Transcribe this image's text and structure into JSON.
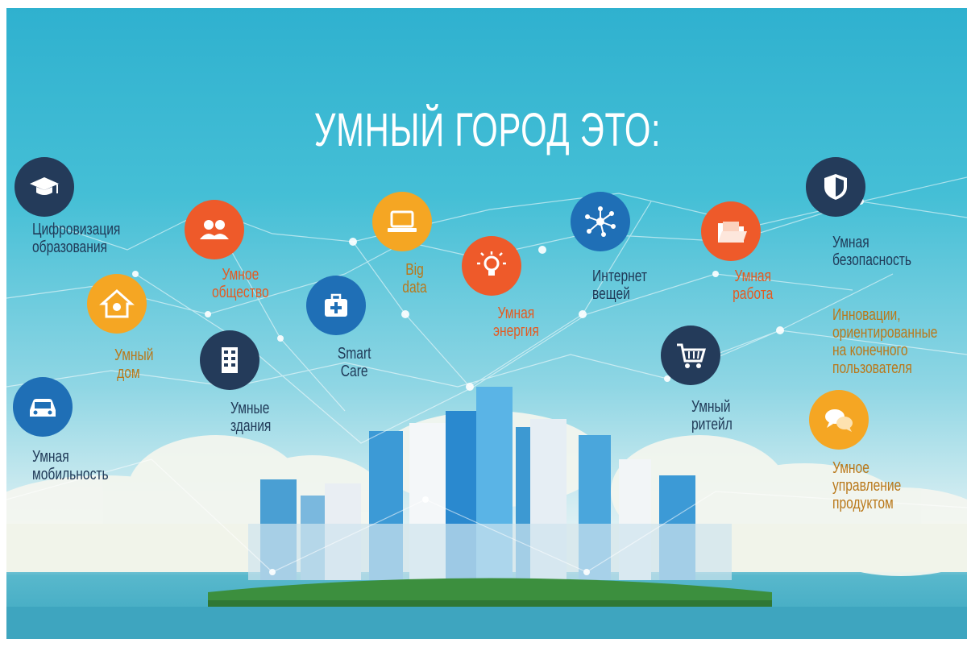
{
  "title": "УМНЫЙ ГОРОД ЭТО:",
  "colors": {
    "navy": "#243b5a",
    "blue": "#1f6fb6",
    "orange": "#ee5a2a",
    "yellow": "#f5a623",
    "sky": "#45bfd6"
  },
  "items": [
    {
      "icon": "graduation-cap-icon",
      "line1": "Цифровизация",
      "line2": "образования"
    },
    {
      "icon": "people-icon",
      "line1": "Умное",
      "line2": "общество"
    },
    {
      "icon": "house-icon",
      "line1": "Умный",
      "line2": "дом"
    },
    {
      "icon": "building-icon",
      "line1": "Умные",
      "line2": "здания"
    },
    {
      "icon": "medical-kit-icon",
      "line1": "Smart",
      "line2": "Care"
    },
    {
      "icon": "laptop-icon",
      "line1": "Big",
      "line2": "data"
    },
    {
      "icon": "lightbulb-icon",
      "line1": "Умная",
      "line2": "энергия"
    },
    {
      "icon": "network-icon",
      "line1": "Интернет",
      "line2": "вещей"
    },
    {
      "icon": "folder-icon",
      "line1": "Умная",
      "line2": "работа"
    },
    {
      "icon": "shield-icon",
      "line1": "Умная",
      "line2": "безопасность"
    },
    {
      "icon": "shopping-cart-icon",
      "line1": "Умный",
      "line2": "ритейл"
    },
    {
      "icon": "car-icon",
      "line1": "Умная",
      "line2": "мобильность"
    },
    {
      "icon": "chat-bubbles-icon",
      "line1": "Умное",
      "line2": "управление",
      "line3": "продуктом"
    }
  ],
  "innovation": {
    "line1": "Инновации,",
    "line2": "ориентированные",
    "line3": "на конечного",
    "line4": "пользователя"
  }
}
